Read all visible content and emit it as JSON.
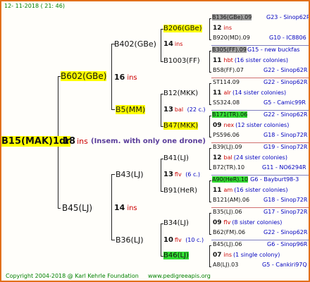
{
  "header": {
    "date": "12- 11-2018 ( 21: 46)"
  },
  "root": {
    "name": "B15(MAK)1dr",
    "ins_num": "18",
    "ins_label": "ins",
    "note": "(Insem. with only one drone)"
  },
  "gen1": [
    {
      "name": "B602(GBe)",
      "ins_num": "16",
      "ins_label": "ins"
    },
    {
      "name": "B45(LJ)",
      "ins_num": "14",
      "ins_label": "ins"
    }
  ],
  "gen2": [
    {
      "name": "B402(GBe)",
      "ins_num": "14",
      "ins_label": "ins"
    },
    {
      "name": "B5(MM)",
      "ins_num": "13",
      "ins_label": "bal",
      "extra": "(22 c.)"
    },
    {
      "name": "B43(LJ)",
      "ins_num": "13",
      "ins_label": "flv",
      "extra": "(6 c.)"
    },
    {
      "name": "B36(LJ)",
      "ins_num": "10",
      "ins_label": "flv",
      "extra": "(10 c.)"
    }
  ],
  "gen3": [
    {
      "name": "B206(GBe)",
      "ins_num": "12",
      "ins_label": "ins"
    },
    {
      "name": "B1003(FF)"
    },
    {
      "name": "B12(MKK)"
    },
    {
      "name": "B47(MKK)"
    },
    {
      "name": "B41(LJ)"
    },
    {
      "name": "B91(HeR)"
    },
    {
      "name": "B34(LJ)"
    },
    {
      "name": "B46(LJ)"
    }
  ],
  "gen4": [
    {
      "queen": "B136(GBe).09",
      "line": "G23 - Sinop62R"
    },
    {
      "ins_num": "12",
      "ins_label": "ins"
    },
    {
      "queen": "B920(MD).09",
      "line": "G10 - IC8806"
    },
    {
      "queen": "B305(FF).09",
      "line": "G15 - new buckfas"
    },
    {
      "ins_num": "11",
      "ins_label": "hbt",
      "colonies": "(16 sister colonies)"
    },
    {
      "queen": "B58(FF).07",
      "line": "G22 - Sinop62R"
    },
    {
      "queen": "ST114.09",
      "line": "G22 - Sinop62R"
    },
    {
      "ins_num": "11",
      "ins_label": "alr",
      "colonies": "(14 sister colonies)"
    },
    {
      "queen": "SS324.08",
      "line": "G5 - Camic99R"
    },
    {
      "queen": "B171(TR).06",
      "line": "G22 - Sinop62R"
    },
    {
      "ins_num": "09",
      "ins_label": "nex",
      "colonies": "(12 sister colonies)"
    },
    {
      "queen": "PS596.06",
      "line": "G18 - Sinop72R"
    },
    {
      "queen": "B39(LJ).09",
      "line": "G19 - Sinop72R"
    },
    {
      "ins_num": "12",
      "ins_label": "bal",
      "colonies": "(24 sister colonies)"
    },
    {
      "queen": "B72(TR).10",
      "line": "G11 - NO6294R"
    },
    {
      "queen": "A90(HeR).10",
      "line": "G6 - Bayburt98-3"
    },
    {
      "ins_num": "11",
      "ins_label": "am",
      "colonies": "(16 sister colonies)"
    },
    {
      "queen": "B121(AM).06",
      "line": "G18 - Sinop72R"
    },
    {
      "queen": "B35(LJ).06",
      "line": "G17 - Sinop72R"
    },
    {
      "ins_num": "09",
      "ins_label": "flv",
      "colonies": "(8 sister colonies)"
    },
    {
      "queen": "B62(FM).06",
      "line": "G22 - Sinop62R"
    },
    {
      "queen": "B45(LJ).06",
      "line": "G6 - Sinop96R"
    },
    {
      "ins_num": "07",
      "ins_label": "ins",
      "colonies": "(1 single colony)"
    },
    {
      "queen": "A8(LJ).03",
      "line": "G5 - Cankiri97Q"
    }
  ],
  "footer": {
    "copyright": "Copyright 2004-2018 @ Karl Kehrle Foundation",
    "website": "www.pedigreeapis.org"
  }
}
